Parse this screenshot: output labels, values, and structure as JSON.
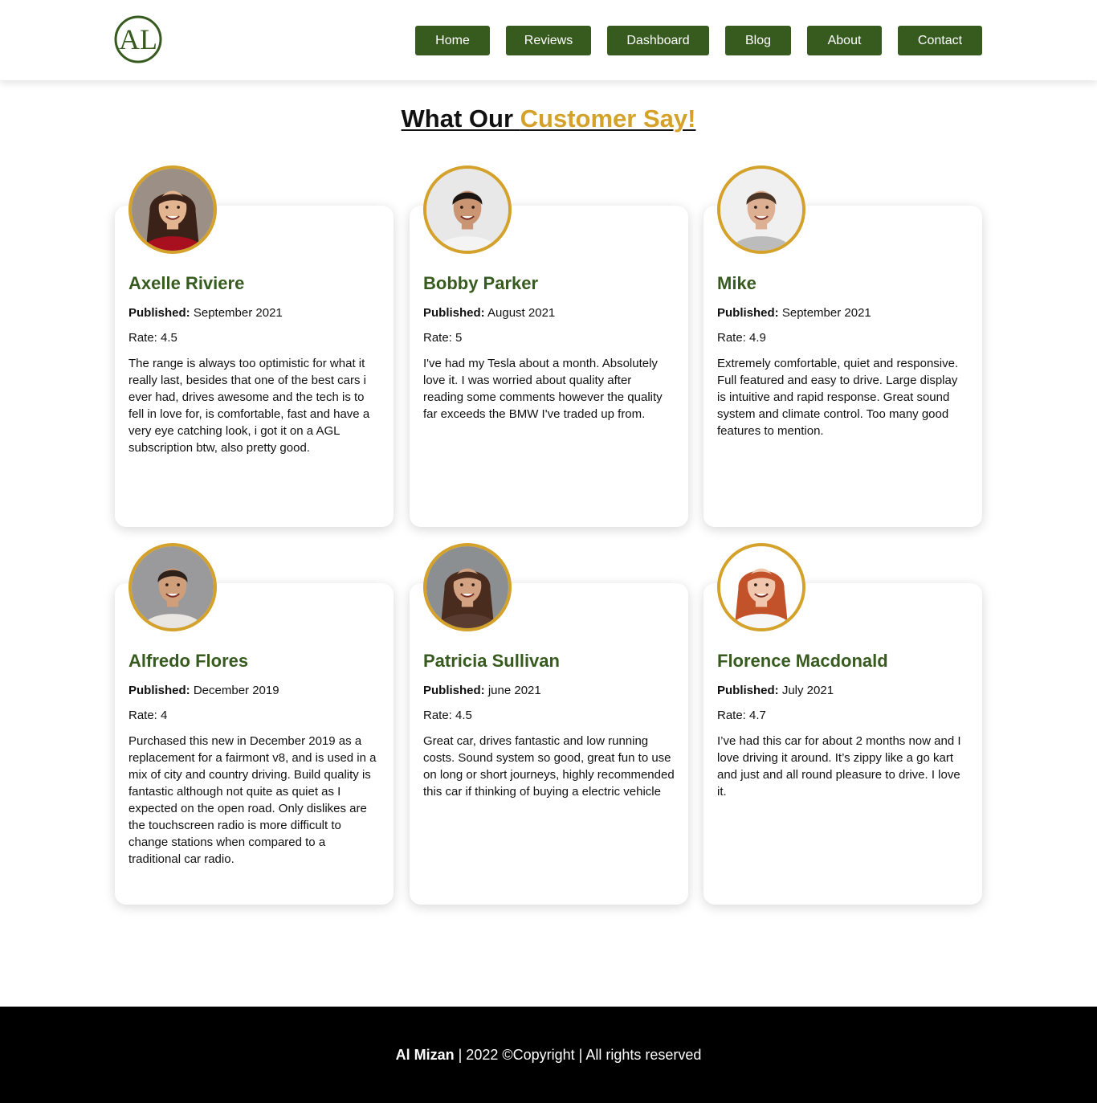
{
  "brand": {
    "logo_text": "AL",
    "accent": "#375b1f",
    "gold": "#d4a12a"
  },
  "nav": [
    "Home",
    "Reviews",
    "Dashboard",
    "Blog",
    "About",
    "Contact"
  ],
  "headline": {
    "part1": "What Our ",
    "part2": "Customer Say!"
  },
  "reviews": [
    {
      "name": "Axelle Riviere",
      "published_label": "Published:",
      "published": "September 2021",
      "rate": "Rate: 4.5",
      "text": "The range is always too optimistic for what it really last, besides that one of the best cars i ever had, drives awesome and the tech is to fell in love for, is comfortable, fast and have a very eye catching look, i got it on a AGL subscription btw, also pretty good.",
      "avatar": {
        "bg": "#9c8f86",
        "skin": "#e2b48f",
        "hair": "#3a2218",
        "shirt": "#a80f1f",
        "hair_style": "long"
      }
    },
    {
      "name": "Bobby Parker",
      "published_label": "Published:",
      "published": "August 2021",
      "rate": "Rate: 5",
      "text": "I've had my Tesla about a month. Absolutely love it. I was worried about quality after reading some comments however the quality far exceeds the BMW I've traded up from.",
      "avatar": {
        "bg": "#e8e8e8",
        "skin": "#c99572",
        "hair": "#1c1512",
        "shirt": "#f4f4f4",
        "hair_style": "short"
      }
    },
    {
      "name": "Mike",
      "published_label": "Published:",
      "published": "September 2021",
      "rate": "Rate: 4.9",
      "text": "Extremely comfortable, quiet and responsive. Full featured and easy to drive. Large display is intuitive and rapid response. Great sound system and climate control. Too many good features to mention.",
      "avatar": {
        "bg": "#f0f0f0",
        "skin": "#ddb093",
        "hair": "#4a3426",
        "shirt": "#bcbcbc",
        "hair_style": "short"
      }
    },
    {
      "name": "Alfredo Flores",
      "published_label": "Published:",
      "published": "December 2019",
      "rate": "Rate: 4",
      "text": "Purchased this new in December 2019 as a replacement for a fairmont v8, and is used in a mix of city and country driving. Build quality is fantastic although not quite as quiet as I expected on the open road. Only dislikes are the touchscreen radio is more difficult to change stations when compared to a traditional car radio.",
      "avatar": {
        "bg": "#9a9a9c",
        "skin": "#cf9e7b",
        "hair": "#2d211a",
        "shirt": "#e9e6e2",
        "hair_style": "short"
      }
    },
    {
      "name": "Patricia Sullivan",
      "published_label": "Published:",
      "published": "june 2021",
      "rate": "Rate: 4.5",
      "text": "Great car, drives fantastic and low running costs. Sound system so good, great fun to use on long or short journeys, highly recommended this car if thinking of buying a electric vehicle",
      "avatar": {
        "bg": "#8c8f92",
        "skin": "#d3a283",
        "hair": "#4a2c1e",
        "shirt": "#5a3d30",
        "hair_style": "long"
      }
    },
    {
      "name": "Florence Macdonald",
      "published_label": "Published:",
      "published": "July 2021",
      "rate": "Rate: 4.7",
      "text": "I’ve had this car for about 2 months now and I love driving it around. It’s zippy like a go kart and just and all round pleasure to drive. I love it.",
      "avatar": {
        "bg": "#ffffff",
        "skin": "#f0c7ad",
        "hair": "#c2522a",
        "shirt": "#f7f7f7",
        "hair_style": "long"
      }
    }
  ],
  "footer": {
    "brand": "Al Mizan",
    "text": " | 2022 ©Copyright | All rights reserved"
  }
}
